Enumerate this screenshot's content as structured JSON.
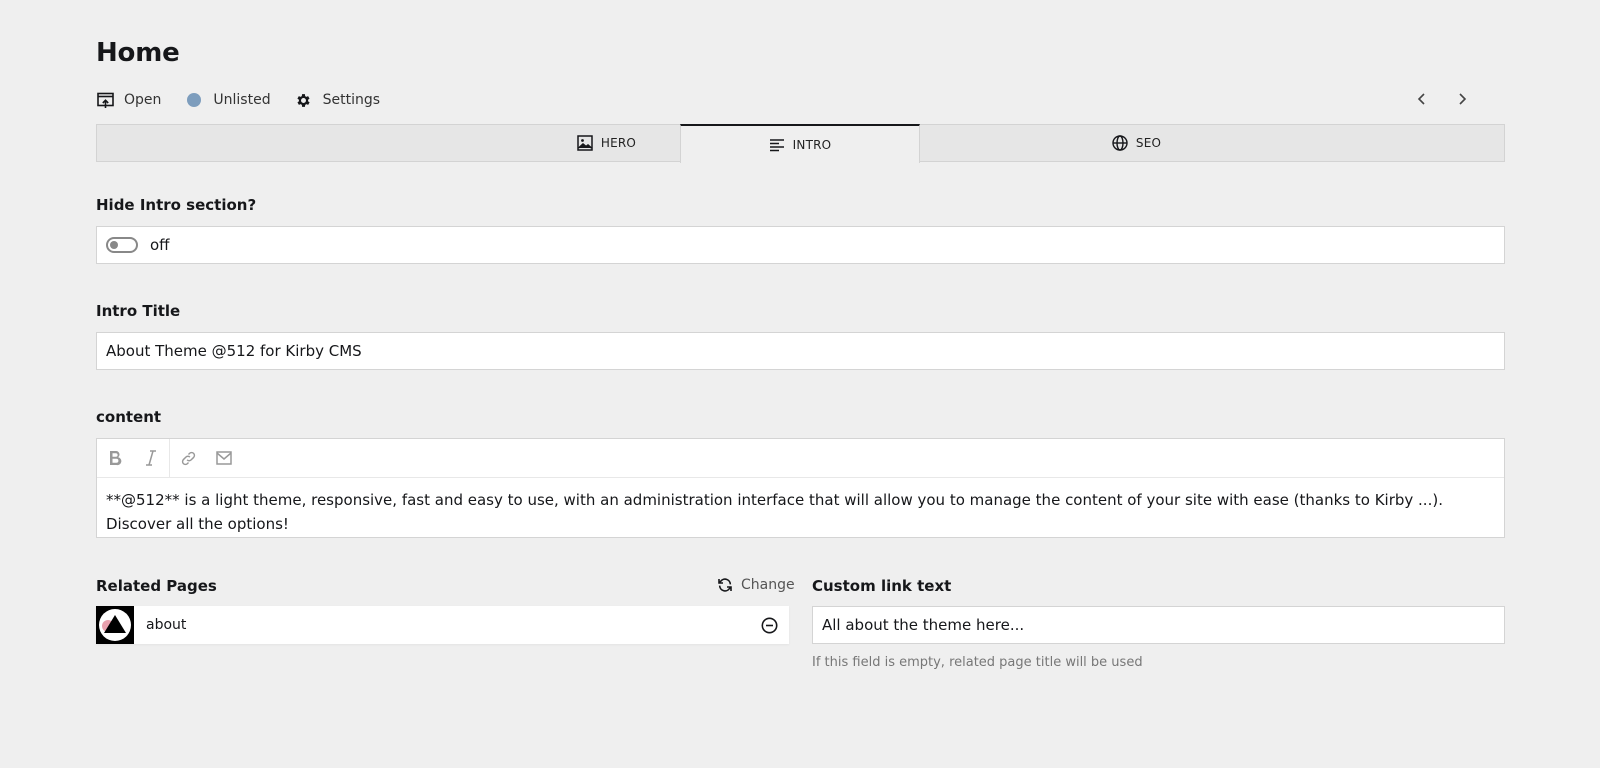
{
  "header": {
    "title": "Home",
    "toolbar": {
      "open_label": "Open",
      "status_label": "Unlisted",
      "settings_label": "Settings"
    }
  },
  "tabs": [
    {
      "label": "HERO",
      "icon": "image-icon"
    },
    {
      "label": "INTRO",
      "icon": "text-align-left-icon",
      "active": true
    },
    {
      "label": "SEO",
      "icon": "globe-icon"
    }
  ],
  "fields": {
    "hide_intro": {
      "label": "Hide Intro section?",
      "value_text": "off"
    },
    "intro_title": {
      "label": "Intro Title",
      "value": "About Theme @512 for Kirby CMS"
    },
    "content": {
      "label": "content",
      "value": "**@512** is a light theme, responsive, fast and easy to use, with an administration interface that will allow you to manage the content of your site with ease (thanks to Kirby ...). Discover all the options!"
    },
    "related_pages": {
      "label": "Related Pages",
      "change_label": "Change",
      "items": [
        {
          "title": "about"
        }
      ]
    },
    "custom_link_text": {
      "label": "Custom link text",
      "value": "All about the theme here...",
      "help": "If this field is empty, related page title will be used"
    }
  },
  "colors": {
    "background": "#efefef",
    "status_unlisted": "#7d9dbd",
    "text": "#16171a"
  }
}
